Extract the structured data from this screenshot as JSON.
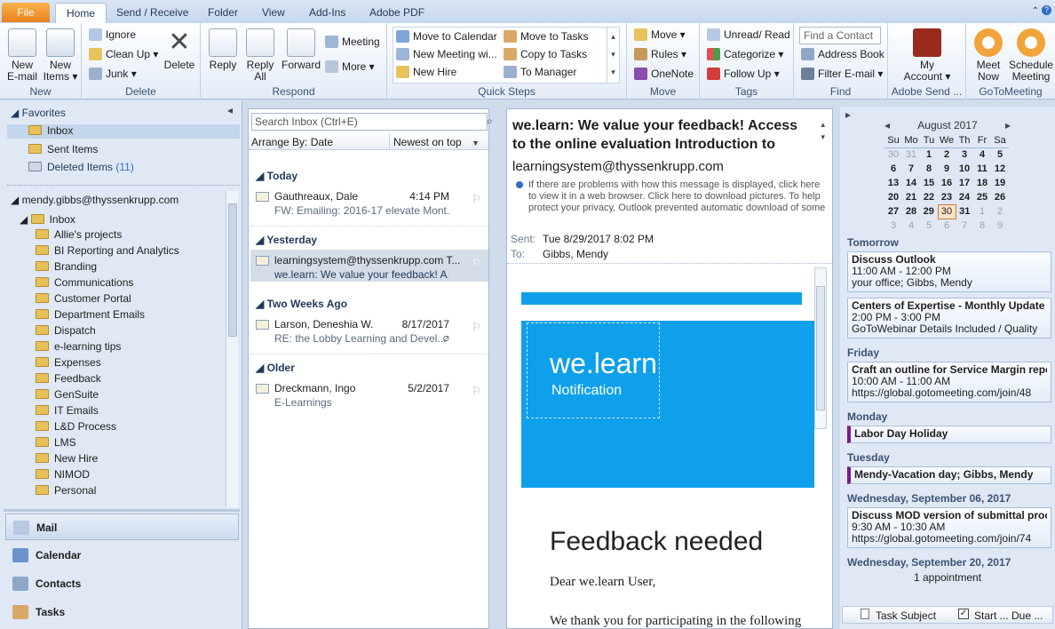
{
  "tabs": [
    "File",
    "Home",
    "Send / Receive",
    "Folder",
    "View",
    "Add-Ins",
    "Adobe PDF"
  ],
  "ribbon": {
    "new": {
      "label": "New",
      "new_email": "New E-mail",
      "new_items": "New Items"
    },
    "delete": {
      "label": "Delete",
      "ignore": "Ignore",
      "clean_up": "Clean Up",
      "junk": "Junk",
      "delete": "Delete"
    },
    "respond": {
      "label": "Respond",
      "reply": "Reply",
      "reply_all": "Reply All",
      "forward": "Forward",
      "meeting": "Meeting",
      "more": "More"
    },
    "quick_steps": {
      "label": "Quick Steps",
      "items": [
        "Move to Calendar",
        "New Meeting wi...",
        "New Hire",
        "Move to Tasks",
        "Copy to Tasks",
        "To Manager"
      ]
    },
    "move": {
      "label": "Move",
      "move": "Move",
      "rules": "Rules",
      "onenote": "OneNote"
    },
    "tags": {
      "label": "Tags",
      "unread": "Unread/ Read",
      "categorize": "Categorize",
      "follow_up": "Follow Up"
    },
    "find": {
      "label": "Find",
      "contact_placeholder": "Find a Contact",
      "address_book": "Address Book",
      "filter": "Filter E-mail"
    },
    "adobe": {
      "label": "Adobe Send ...",
      "my_account": "My Account"
    },
    "goto": {
      "label": "GoToMeeting",
      "meet_now": "Meet Now",
      "schedule": "Schedule Meeting"
    }
  },
  "nav": {
    "favorites": "Favorites",
    "fav_items": [
      "Inbox",
      "Sent Items",
      "Deleted Items"
    ],
    "deleted_count": "(11)",
    "account": "mendy.gibbs@thyssenkrupp.com",
    "inbox": "Inbox",
    "folders": [
      "Allie's projects",
      "BI Reporting and Analytics",
      "Branding",
      "Communications",
      "Customer Portal",
      "Department Emails",
      "Dispatch",
      "e-learning tips",
      "Expenses",
      "Feedback",
      "GenSuite",
      "IT Emails",
      "L&D Process",
      "LMS",
      "New Hire",
      "NIMOD",
      "Personal"
    ],
    "buttons": [
      "Mail",
      "Calendar",
      "Contacts",
      "Tasks"
    ]
  },
  "list": {
    "search_placeholder": "Search Inbox (Ctrl+E)",
    "arrange": "Arrange By: Date",
    "order": "Newest on top",
    "groups": [
      "Today",
      "Yesterday",
      "Two Weeks Ago",
      "Older"
    ],
    "messages": [
      {
        "sender": "Gauthreaux, Dale",
        "date": "4:14 PM",
        "subject": "FW: Emailing: 2016-17 elevate Mont..."
      },
      {
        "sender": "learningsystem@thyssenkrupp.com T...",
        "date": "",
        "subject": "we.learn: We value your feedback! A..."
      },
      {
        "sender": "Larson, Deneshia W.",
        "date": "8/17/2017",
        "subject": "RE: the Lobby Learning and Devel..."
      },
      {
        "sender": "Dreckmann, Ingo",
        "date": "5/2/2017",
        "subject": "E-Learnings"
      }
    ]
  },
  "reading": {
    "subject": "we.learn: We value your feedback! Access to the online evaluation Introduction to",
    "from": "learningsystem@thyssenkrupp.com",
    "info": "If there are problems with how this message is displayed, click here to view it in a web browser. Click here to download pictures. To help protect your privacy, Outlook prevented automatic download of some pictures in this",
    "sent_label": "Sent:",
    "sent": "Tue 8/29/2017 8:02 PM",
    "to_label": "To:",
    "to": "Gibbs, Mendy",
    "banner_title": "we.learn",
    "banner_sub": "Notification",
    "heading": "Feedback needed",
    "greeting": "Dear we.learn User,",
    "body": "We thank you for participating in the following"
  },
  "todo": {
    "month": "August 2017",
    "weekdays": [
      "Su",
      "Mo",
      "Tu",
      "We",
      "Th",
      "Fr",
      "Sa"
    ],
    "weeks": [
      [
        "30",
        "31",
        "1",
        "2",
        "3",
        "4",
        "5"
      ],
      [
        "6",
        "7",
        "8",
        "9",
        "10",
        "11",
        "12"
      ],
      [
        "13",
        "14",
        "15",
        "16",
        "17",
        "18",
        "19"
      ],
      [
        "20",
        "21",
        "22",
        "23",
        "24",
        "25",
        "26"
      ],
      [
        "27",
        "28",
        "29",
        "30",
        "31",
        "1",
        "2"
      ],
      [
        "3",
        "4",
        "5",
        "6",
        "7",
        "8",
        "9"
      ]
    ],
    "days": [
      "Tomorrow",
      "Friday",
      "Monday",
      "Tuesday",
      "Wednesday, September 06, 2017",
      "Wednesday, September 20, 2017"
    ],
    "appts": [
      {
        "t": "Discuss Outlook",
        "time": "11:00 AM - 12:00 PM",
        "loc": "your office; Gibbs, Mendy"
      },
      {
        "t": "Centers of Expertise - Monthly Update Call",
        "time": "2:00 PM - 3:00 PM",
        "loc": "GoToWebinar Details Included / Quality"
      },
      {
        "t": "Craft an outline for Service Margin reporti",
        "time": "10:00 AM - 11:00 AM",
        "loc": "https://global.gotomeeting.com/join/48"
      },
      {
        "t": "Labor Day Holiday"
      },
      {
        "t": "Mendy-Vacation day; Gibbs, Mendy"
      },
      {
        "t": "Discuss MOD version of submittal process",
        "time": "9:30 AM - 10:30 AM",
        "loc": "https://global.gotomeeting.com/join/74"
      }
    ],
    "one_appt": "1 appointment",
    "task_subject": "Task Subject",
    "start": "Start ...",
    "due": "Due ..."
  }
}
